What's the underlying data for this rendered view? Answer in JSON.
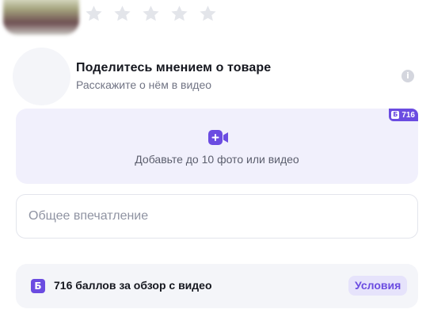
{
  "rating": {
    "stars_total": 5,
    "stars_filled": 0,
    "star_color": "#e3e5ea"
  },
  "share": {
    "title": "Поделитесь мнением о товаре",
    "subtitle": "Расскажите о нём в видео",
    "info_icon": "i"
  },
  "upload": {
    "badge_icon": "Б",
    "badge_points": "716",
    "label": "Добавьте до 10 фото или видео"
  },
  "impression": {
    "value": "",
    "placeholder": "Общее впечатление"
  },
  "points": {
    "icon": "Б",
    "text": "716 баллов за обзор с видео",
    "terms_label": "Условия"
  },
  "colors": {
    "accent": "#6b4ce1",
    "upload_bg": "#f1f0fc",
    "points_bg": "#f4f5f9",
    "star_empty": "#e3e5ea"
  }
}
